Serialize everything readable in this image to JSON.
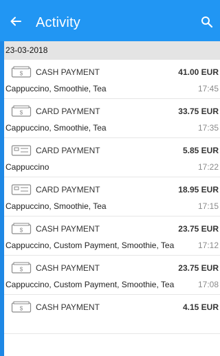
{
  "appbar": {
    "title": "Activity",
    "back_icon": "arrow-left-icon",
    "search_icon": "search-icon"
  },
  "date": "23-03-2018",
  "transactions": [
    {
      "type": "CASH PAYMENT",
      "icon": "cash-icon",
      "amount": "41.00 EUR",
      "items": "Cappuccino, Smoothie, Tea",
      "time": "17:45"
    },
    {
      "type": "CARD PAYMENT",
      "icon": "cash-icon",
      "amount": "33.75 EUR",
      "items": "Cappuccino, Smoothie, Tea",
      "time": "17:35"
    },
    {
      "type": "CARD PAYMENT",
      "icon": "card-icon",
      "amount": "5.85 EUR",
      "items": "Cappuccino",
      "time": "17:22"
    },
    {
      "type": "CARD PAYMENT",
      "icon": "card-icon",
      "amount": "18.95 EUR",
      "items": "Cappuccino, Smoothie, Tea",
      "time": "17:15"
    },
    {
      "type": "CASH PAYMENT",
      "icon": "cash-icon",
      "amount": "23.75 EUR",
      "items": "Cappuccino, Custom Payment, Smoothie, Tea",
      "time": "17:12"
    },
    {
      "type": "CASH PAYMENT",
      "icon": "cash-icon",
      "amount": "23.75 EUR",
      "items": "Cappuccino, Custom Payment, Smoothie, Tea",
      "time": "17:08"
    },
    {
      "type": "CASH PAYMENT",
      "icon": "cash-icon",
      "amount": "4.15 EUR",
      "items": "",
      "time": ""
    }
  ],
  "colors": {
    "appbar": "#2196f3",
    "frame": "#1e88e5",
    "date_header_bg": "#e4e4e4",
    "time_text": "#8a8a8a"
  }
}
